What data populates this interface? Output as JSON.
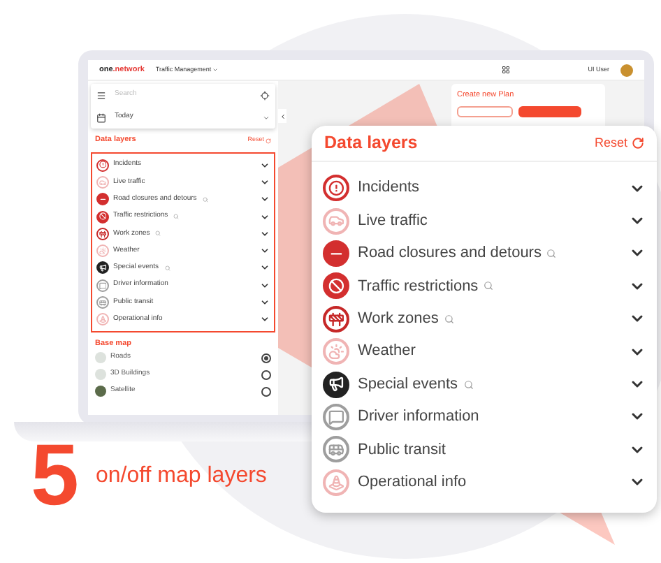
{
  "app_bar": {
    "logo_prefix": "one",
    "logo_suffix": ".network",
    "menu": "Traffic Management",
    "user": "UI User"
  },
  "plan_card": {
    "title": "Create new Plan"
  },
  "sidebar": {
    "search": {
      "placeholder": "Search"
    },
    "date": "Today",
    "data_layers": {
      "title": "Data layers",
      "reset": "Reset",
      "layers": [
        {
          "label": "Incidents",
          "color": "#d32f2f",
          "filled": false,
          "search": false
        },
        {
          "label": "Live traffic",
          "color": "#f0b4b4",
          "filled": false,
          "search": false
        },
        {
          "label": "Road closures and detours",
          "color": "#d32f2f",
          "filled": true,
          "search": true
        },
        {
          "label": "Traffic restrictions",
          "color": "#d32f2f",
          "filled": true,
          "search": true
        },
        {
          "label": "Work zones",
          "color": "#c62828",
          "filled": false,
          "search": true
        },
        {
          "label": "Weather",
          "color": "#f0b4b4",
          "filled": false,
          "search": false
        },
        {
          "label": "Special events",
          "color": "#222222",
          "filled": true,
          "search": true
        },
        {
          "label": "Driver information",
          "color": "#9e9e9e",
          "filled": false,
          "search": false
        },
        {
          "label": "Public transit",
          "color": "#9e9e9e",
          "filled": false,
          "search": false
        },
        {
          "label": "Operational info",
          "color": "#f0b4b4",
          "filled": false,
          "search": false
        }
      ]
    },
    "base_map": {
      "title": "Base map",
      "items": [
        {
          "label": "Roads",
          "selected": true
        },
        {
          "label": "3D Buildings",
          "selected": false
        },
        {
          "label": "Satellite",
          "selected": false
        }
      ]
    }
  },
  "zoom_panel": {
    "title": "Data layers",
    "reset": "Reset",
    "layers": [
      {
        "label": "Incidents",
        "color": "#d32f2f",
        "filled": false,
        "search": false
      },
      {
        "label": "Live traffic",
        "color": "#f0b4b4",
        "filled": false,
        "search": false
      },
      {
        "label": "Road closures and detours",
        "color": "#d32f2f",
        "filled": true,
        "search": true
      },
      {
        "label": "Traffic restrictions",
        "color": "#d32f2f",
        "filled": true,
        "search": true
      },
      {
        "label": "Work zones",
        "color": "#c62828",
        "filled": false,
        "search": true
      },
      {
        "label": "Weather",
        "color": "#f0b4b4",
        "filled": false,
        "search": false
      },
      {
        "label": "Special events",
        "color": "#222222",
        "filled": true,
        "search": true
      },
      {
        "label": "Driver information",
        "color": "#9e9e9e",
        "filled": false,
        "search": false
      },
      {
        "label": "Public transit",
        "color": "#9e9e9e",
        "filled": false,
        "search": false
      },
      {
        "label": "Operational info",
        "color": "#f0b4b4",
        "filled": false,
        "search": false
      }
    ]
  },
  "caption": {
    "number": "5",
    "text": "on/off map layers"
  }
}
